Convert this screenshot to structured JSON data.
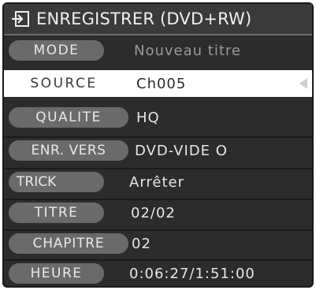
{
  "header": {
    "icon": "record-icon",
    "title": "ENREGISTRER (DVD+RW)"
  },
  "rows": [
    {
      "label": "MODE",
      "value": "Nouveau titre"
    },
    {
      "label": "SOURCE",
      "value": "Ch005"
    },
    {
      "label": "QUALITE",
      "value": "HQ"
    },
    {
      "label": "ENR. VERS",
      "value": "DVD-VIDE O"
    },
    {
      "label": "TRICK",
      "value": "Arrêter"
    },
    {
      "label": "TITRE",
      "value": "02/02"
    },
    {
      "label": "CHAPITRE",
      "value": "02"
    },
    {
      "label": "HEURE",
      "value": "0:06:27/1:51:00"
    }
  ],
  "selected_row": "SOURCE",
  "colors": {
    "panel": "#2c2c2c",
    "pill": "#6a6a6a",
    "selected_bg": "#ffffff",
    "text": "#e6e6e6"
  }
}
